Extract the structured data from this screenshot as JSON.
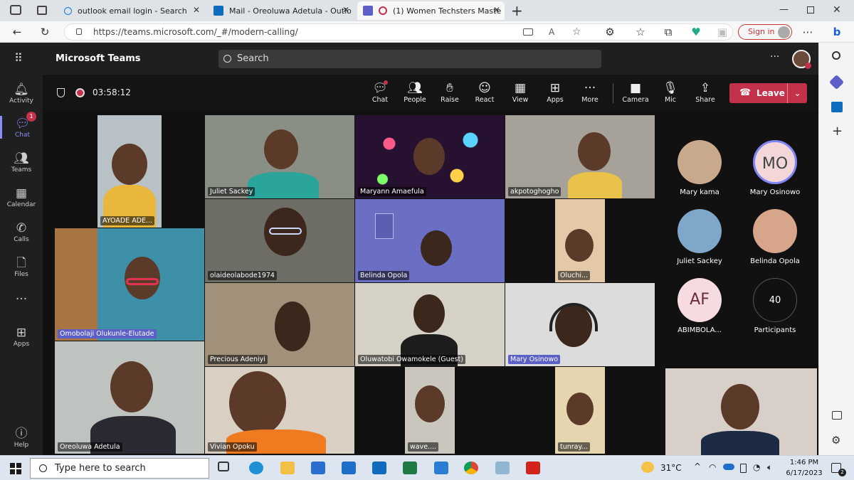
{
  "browser": {
    "tabs": [
      {
        "label": "outlook email login - Search",
        "active": false
      },
      {
        "label": "Mail - Oreoluwa Adetula - Outlo",
        "active": false
      },
      {
        "label": "(1) Women Techsters Maste",
        "active": true
      }
    ],
    "url": "https://teams.microsoft.com/_#/modern-calling/",
    "signin_label": "Sign in"
  },
  "teams": {
    "title": "Microsoft Teams",
    "search_placeholder": "Search",
    "rail": [
      {
        "label": "Activity",
        "icon": "bell-icon"
      },
      {
        "label": "Chat",
        "icon": "chat-icon",
        "badge": "1",
        "active": true
      },
      {
        "label": "Teams",
        "icon": "teams-icon"
      },
      {
        "label": "Calendar",
        "icon": "calendar-icon"
      },
      {
        "label": "Calls",
        "icon": "phone-icon"
      },
      {
        "label": "Files",
        "icon": "file-icon"
      },
      {
        "label": "Apps",
        "icon": "apps-icon"
      },
      {
        "label": "Help",
        "icon": "help-icon"
      }
    ],
    "more_label": "···",
    "meeting": {
      "timer": "03:58:12",
      "toolbar": [
        {
          "label": "Chat",
          "icon": "chat-icon"
        },
        {
          "label": "People",
          "icon": "people-icon"
        },
        {
          "label": "Raise",
          "icon": "hand-icon"
        },
        {
          "label": "React",
          "icon": "smiley-icon"
        },
        {
          "label": "View",
          "icon": "grid-icon"
        },
        {
          "label": "Apps",
          "icon": "plus-square-icon"
        },
        {
          "label": "More",
          "icon": "more-icon"
        },
        {
          "label": "Camera",
          "icon": "camera-icon"
        },
        {
          "label": "Mic",
          "icon": "mic-icon"
        },
        {
          "label": "Share",
          "icon": "share-icon"
        }
      ],
      "leave_label": "Leave",
      "participants_grid": [
        "AYOADE ADE...",
        "Juliet Sackey",
        "Maryann Amaefula",
        "akpotoghogho",
        "olaideolabode1974",
        "Belinda Opola",
        "Oluchi...",
        "Omobolaji Olukunle-Elutade",
        "Precious Adeniyi",
        "Oluwatobi Owamokele (Guest)",
        "Mary Osinowo",
        "Oreoluwa Adetula",
        "Vivian Opoku",
        "wave....",
        "tunray..."
      ],
      "roster": [
        {
          "name": "Mary kama",
          "initials": ""
        },
        {
          "name": "Mary Osinowo",
          "initials": "MO"
        },
        {
          "name": "Juliet Sackey",
          "initials": ""
        },
        {
          "name": "Belinda Opola",
          "initials": ""
        },
        {
          "name": "ABIMBOLA...",
          "initials": "AF"
        },
        {
          "name": "Participants",
          "initials": "40"
        }
      ]
    }
  },
  "taskbar": {
    "search_placeholder": "Type here to search",
    "weather": "31°C",
    "time": "1:46 PM",
    "date": "6/17/2023"
  }
}
